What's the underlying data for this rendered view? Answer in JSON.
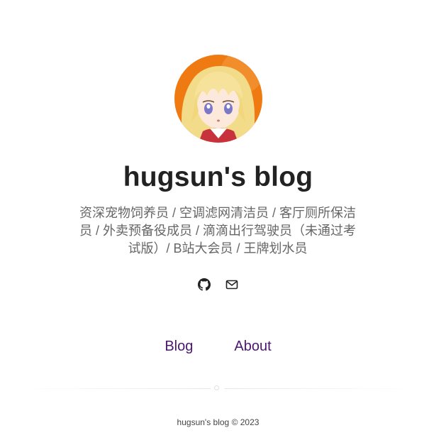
{
  "header": {
    "title": "hugsun's blog",
    "tagline": "资深宠物饲养员 / 空调滤网清洁员 / 客厅厕所保洁员 / 外卖预备役成员 / 滴滴出行驾驶员（未通过考试版）/ B站大会员 / 王牌划水员"
  },
  "socials": [
    {
      "icon": "github-icon"
    },
    {
      "icon": "mail-icon"
    }
  ],
  "nav": {
    "blog": "Blog",
    "about": "About"
  },
  "footer": {
    "text": "hugsun's blog © 2023"
  },
  "colors": {
    "nav_link": "#4b176e",
    "title": "#222222",
    "tagline": "#666666",
    "avatar_bg": "#f07a12"
  }
}
